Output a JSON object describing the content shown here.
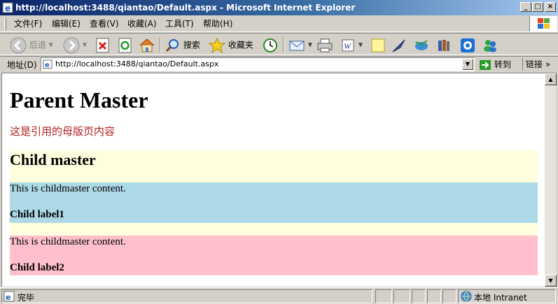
{
  "window": {
    "title": "http://localhost:3488/qiantao/Default.aspx - Microsoft Internet Explorer",
    "min_glyph": "_",
    "max_glyph": "□",
    "close_glyph": "×"
  },
  "menu": [
    "文件(F)",
    "编辑(E)",
    "查看(V)",
    "收藏(A)",
    "工具(T)",
    "帮助(H)"
  ],
  "toolbar": {
    "back_label": "后退",
    "search_label": "搜索",
    "favorites_label": "收藏夹"
  },
  "address": {
    "label": "地址(D)",
    "url": "http://localhost:3488/qiantao/Default.aspx",
    "go_label": "转到",
    "links_label": "链接"
  },
  "page": {
    "heading": "Parent Master",
    "red_text": "这是引用的母版页内容",
    "child_heading": "Child master",
    "content1": "This is childmaster content.",
    "label1": "Child label1",
    "content2": "This is childmaster content.",
    "label2": "Child label2"
  },
  "colors": {
    "red_text": "#b22222",
    "yellow_bg": "#ffffe0",
    "blue_bg": "#add8e6",
    "pink_bg": "#ffc0cb"
  },
  "status": {
    "text": "完毕",
    "zone": "本地 Intranet"
  }
}
